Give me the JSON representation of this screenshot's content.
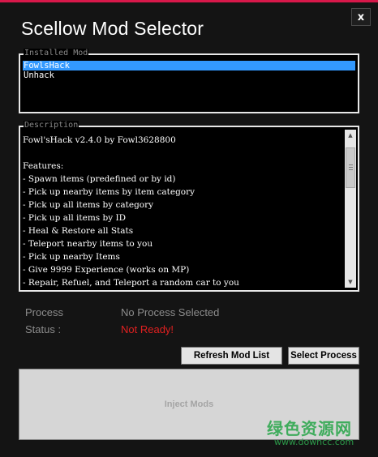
{
  "window": {
    "title": "Scellow Mod Selector",
    "close_label": "x",
    "accent_color": "#d8184a"
  },
  "installed_mods": {
    "legend": "Installed Mod",
    "items": [
      {
        "label": "FowlsHack",
        "selected": true
      },
      {
        "label": "Unhack",
        "selected": false
      }
    ],
    "selection_color": "#3399ff"
  },
  "description": {
    "legend": "Description",
    "lines": [
      "Fowl'sHack v2.4.0 by Fowl3628800",
      "",
      "Features:",
      "- Spawn items (predefined or by id)",
      "- Pick up nearby items by item category",
      "- Pick up all items by category",
      "- Pick up all items by ID",
      "- Heal & Restore all Stats",
      "- Teleport nearby items to you",
      "- Pick up nearby Items",
      "- Give 9999 Experience (works on MP)",
      "- Repair, Refuel, and Teleport a random car to you"
    ],
    "scrollbar_icons": {
      "up": "scroll-up-arrow-icon",
      "down": "scroll-down-arrow-icon"
    }
  },
  "status": {
    "process_label": "Process",
    "process_value": "No Process Selected",
    "status_label": "Status :",
    "status_value": "Not Ready!",
    "status_color": "#e02020"
  },
  "buttons": {
    "refresh": "Refresh Mod List",
    "select_process": "Select Process",
    "inject": "Inject Mods"
  },
  "watermark": {
    "text": "绿色资源网",
    "url": "www.downcc.com"
  }
}
